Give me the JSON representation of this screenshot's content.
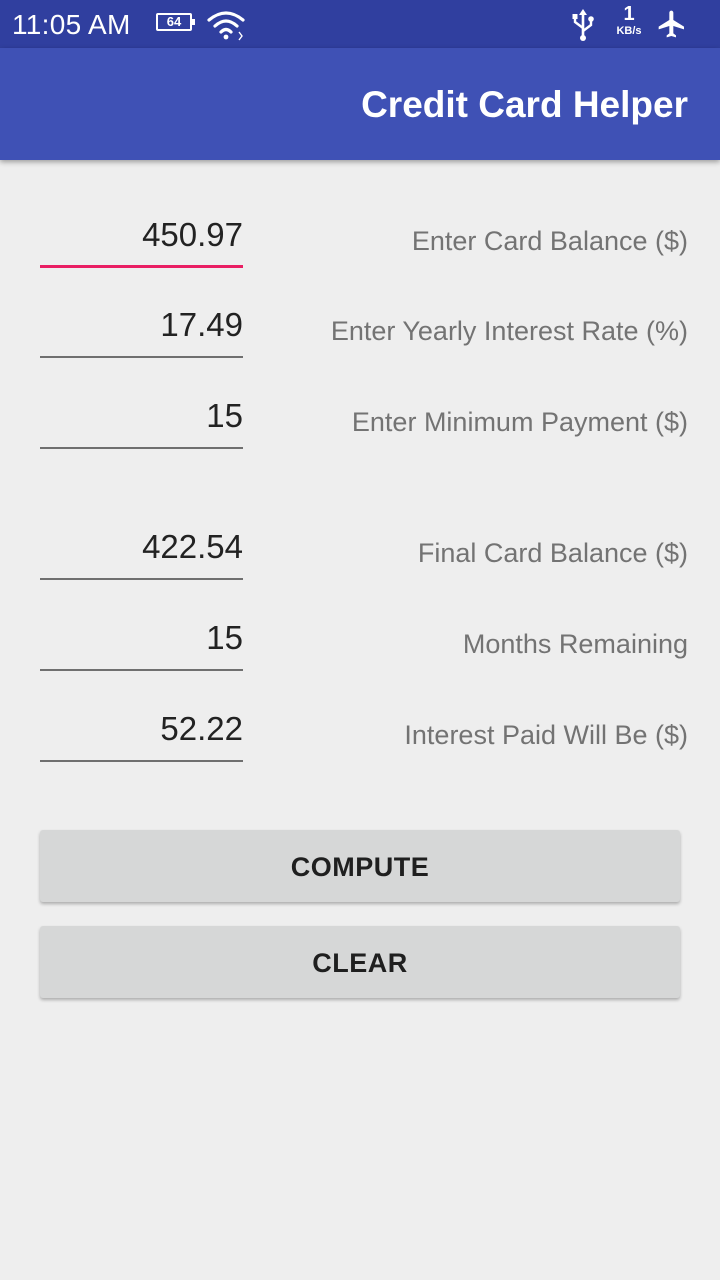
{
  "status_bar": {
    "time": "11:05 AM",
    "battery_level": "64",
    "network_speed_value": "1",
    "network_speed_unit": "KB/s",
    "icons": [
      "battery-icon",
      "wifi-icon",
      "usb-icon",
      "airplane-mode-icon"
    ]
  },
  "app_bar": {
    "title": "Credit Card Helper",
    "color": "#3f51b5"
  },
  "form": {
    "inputs": [
      {
        "label": "Enter Card Balance ($)",
        "value": "450.97"
      },
      {
        "label": "Enter Yearly Interest Rate (%)",
        "value": "17.49"
      },
      {
        "label": "Enter Minimum Payment ($)",
        "value": "15"
      }
    ],
    "outputs": [
      {
        "label": "Final Card Balance ($)",
        "value": "422.54"
      },
      {
        "label": "Months Remaining",
        "value": "15"
      },
      {
        "label": "Interest Paid Will Be ($)",
        "value": "52.22"
      }
    ]
  },
  "buttons": {
    "compute": "COMPUTE",
    "clear": "CLEAR"
  },
  "colors": {
    "status_bar": "#303f9f",
    "focus_underline": "#e91e63",
    "background": "#eeeeee",
    "button": "#d6d7d7"
  }
}
